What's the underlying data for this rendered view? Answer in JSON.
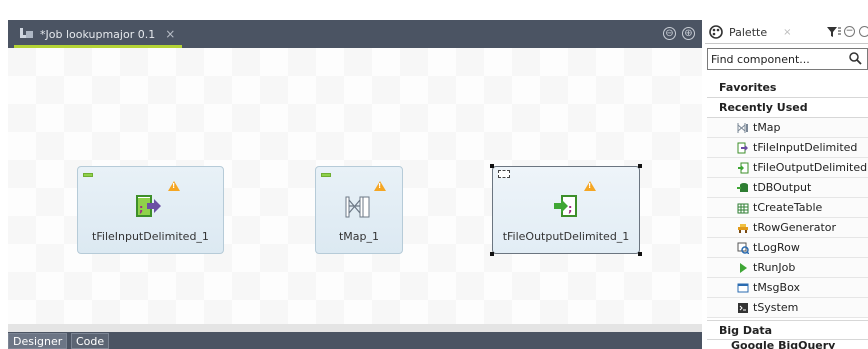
{
  "editor": {
    "tab_title": "*Job lookupmajor 0.1",
    "tab_close": "×",
    "minimize": "⊖",
    "maximize": "⊕"
  },
  "canvas": {
    "nodes": [
      {
        "label": "tFileInputDelimited_1"
      },
      {
        "label": "tMap_1"
      },
      {
        "label": "tFileOutputDelimited_1"
      }
    ]
  },
  "bottom_tabs": [
    "Designer",
    "Code"
  ],
  "palette": {
    "tab_title": "Palette",
    "tab_close": "×",
    "search_placeholder": "Find component...",
    "favorites": "Favorites",
    "recently_used": "Recently Used",
    "items": [
      {
        "label": "tMap",
        "icon": "tmap-icon"
      },
      {
        "label": "tFileInputDelimited",
        "icon": "file-input-icon"
      },
      {
        "label": "tFileOutputDelimited",
        "icon": "file-output-icon"
      },
      {
        "label": "tDBOutput",
        "icon": "db-output-icon"
      },
      {
        "label": "tCreateTable",
        "icon": "create-table-icon"
      },
      {
        "label": "tRowGenerator",
        "icon": "row-generator-icon"
      },
      {
        "label": "tLogRow",
        "icon": "log-row-icon"
      },
      {
        "label": "tRunJob",
        "icon": "run-job-icon"
      },
      {
        "label": "tMsgBox",
        "icon": "msg-box-icon"
      },
      {
        "label": "tSystem",
        "icon": "system-icon"
      }
    ],
    "big_data": "Big Data",
    "next_group": "Google BigQuery"
  },
  "colors": {
    "tab_bar": "#4b5463",
    "active_tab_underline": "#b4d335",
    "node_fill": "#dce9f2",
    "warning": "#f5a623"
  }
}
